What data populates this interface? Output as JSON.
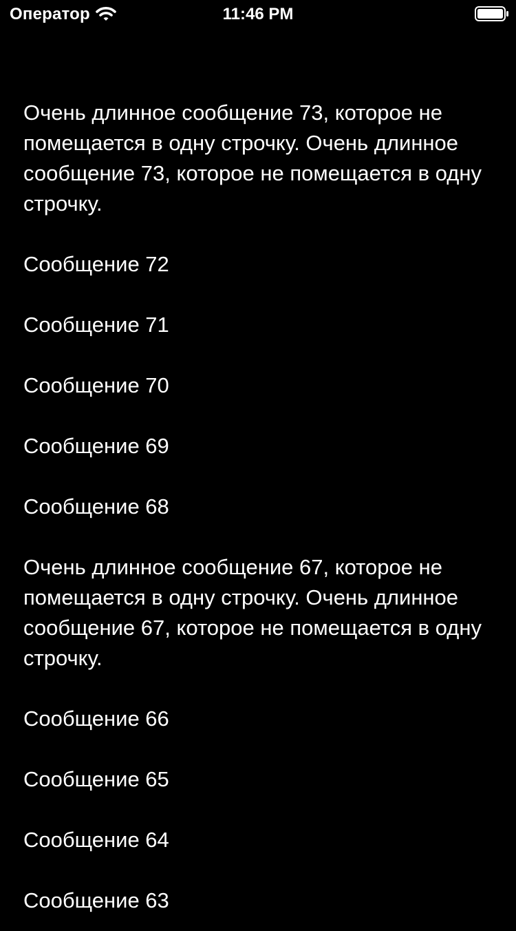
{
  "status_bar": {
    "carrier": "Оператор",
    "time": "11:46 PM",
    "wifi_icon": "wifi-icon",
    "battery_icon": "battery-full-icon"
  },
  "messages": [
    "Очень длинное сообщение 73, которое не помещается в одну строчку. Очень длинное сообщение 73, которое не помещается в одну строчку.",
    "Сообщение 72",
    "Сообщение 71",
    "Сообщение 70",
    "Сообщение 69",
    "Сообщение 68",
    "Очень длинное сообщение 67, которое не помещается в одну строчку. Очень длинное сообщение 67, которое не помещается в одну строчку.",
    "Сообщение 66",
    "Сообщение 65",
    "Сообщение 64",
    "Сообщение 63"
  ],
  "colors": {
    "background": "#000000",
    "text": "#ffffff"
  }
}
